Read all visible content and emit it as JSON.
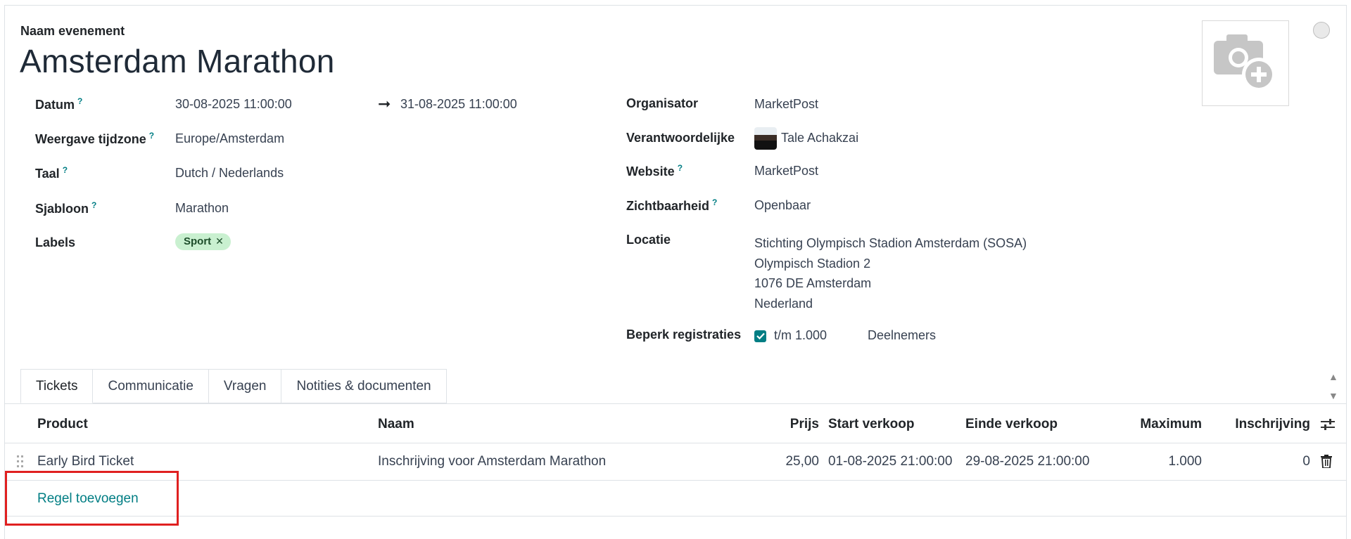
{
  "header": {
    "field_label": "Naam evenement",
    "event_name": "Amsterdam Marathon"
  },
  "left_fields": {
    "datum": {
      "label": "Datum",
      "start": "30-08-2025 11:00:00",
      "arrow": "➞",
      "end": "31-08-2025 11:00:00"
    },
    "tijdzone": {
      "label": "Weergave tijdzone",
      "value": "Europe/Amsterdam"
    },
    "taal": {
      "label": "Taal",
      "value": "Dutch / Nederlands"
    },
    "sjabloon": {
      "label": "Sjabloon",
      "value": "Marathon"
    },
    "labels": {
      "label": "Labels",
      "tags": [
        "Sport"
      ]
    }
  },
  "right_fields": {
    "organisator": {
      "label": "Organisator",
      "value": "MarketPost"
    },
    "verantwoordelijke": {
      "label": "Verantwoordelijke",
      "value": "Tale Achakzai"
    },
    "website": {
      "label": "Website",
      "value": "MarketPost"
    },
    "zichtbaarheid": {
      "label": "Zichtbaarheid",
      "value": "Openbaar"
    },
    "locatie": {
      "label": "Locatie",
      "lines": [
        "Stichting Olympisch Stadion Amsterdam (SOSA)",
        "Olympisch Stadion 2",
        "1076 DE Amsterdam",
        "Nederland"
      ]
    },
    "beperk": {
      "label": "Beperk registraties",
      "checked": true,
      "value": "t/m 1.000",
      "unit": "Deelnemers"
    }
  },
  "help_marker": "?",
  "tabs": [
    {
      "label": "Tickets",
      "active": true
    },
    {
      "label": "Communicatie",
      "active": false
    },
    {
      "label": "Vragen",
      "active": false
    },
    {
      "label": "Notities & documenten",
      "active": false
    }
  ],
  "table": {
    "columns": [
      "Product",
      "Naam",
      "Prijs",
      "Start verkoop",
      "Einde verkoop",
      "Maximum",
      "Inschrijving"
    ],
    "rows": [
      {
        "product": "Early Bird Ticket",
        "naam": "Inschrijving voor Amsterdam Marathon",
        "prijs": "25,00",
        "start": "01-08-2025 21:00:00",
        "einde": "29-08-2025 21:00:00",
        "maximum": "1.000",
        "inschrijving": "0"
      }
    ],
    "add_line": "Regel toevoegen"
  },
  "colors": {
    "accent": "#017e84",
    "tag_bg": "#c9f0d0",
    "highlight": "#e02020"
  }
}
